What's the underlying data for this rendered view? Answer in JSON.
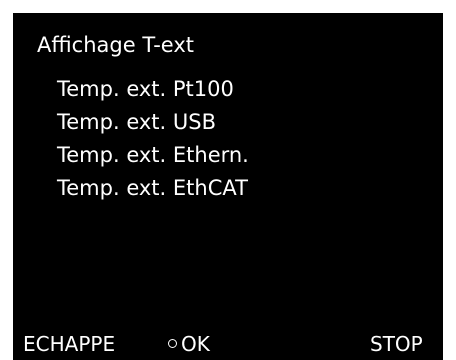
{
  "screen": {
    "title": "Affichage T-ext",
    "menu_items": [
      {
        "label": "Temp. ext. Pt100"
      },
      {
        "label": "Temp. ext. USB"
      },
      {
        "label": "Temp. ext. Ethern."
      },
      {
        "label": "Temp. ext. EthCAT"
      }
    ]
  },
  "softkeys": {
    "left": "ECHAPPE",
    "center": "OK",
    "right": "STOP",
    "center_icon": "circle-icon"
  },
  "colors": {
    "background": "#000000",
    "text": "#ffffff",
    "bezel": "#ffffff"
  }
}
